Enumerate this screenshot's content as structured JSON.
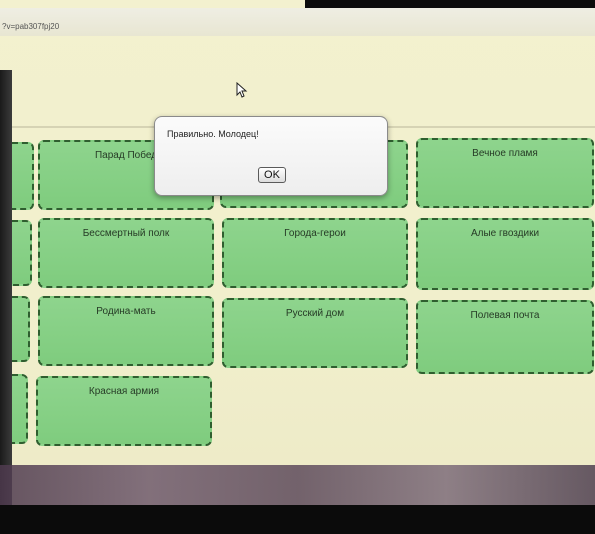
{
  "browser": {
    "url_fragment": "?v=pab307fpj20"
  },
  "cards": [
    {
      "id": "parad",
      "label": "Парад Побед"
    },
    {
      "id": "hidden",
      "label": ""
    },
    {
      "id": "vechnoe",
      "label": "Вечное пламя"
    },
    {
      "id": "bessmertny",
      "label": "Бессмертный полк"
    },
    {
      "id": "goroda",
      "label": "Города-герои"
    },
    {
      "id": "alye",
      "label": "Алые гвоздики"
    },
    {
      "id": "rodina",
      "label": "Родина-мать"
    },
    {
      "id": "russkiy",
      "label": "Русский дом"
    },
    {
      "id": "polevaya",
      "label": "Полевая почта"
    },
    {
      "id": "krasnaya",
      "label": "Красная армия"
    }
  ],
  "dialog": {
    "message": "Правильно. Молодец!",
    "ok_label": "OK"
  },
  "colors": {
    "card_fill": "#8ed48d",
    "card_border": "#2f5e2f",
    "page_background": "#f3f1cf"
  }
}
